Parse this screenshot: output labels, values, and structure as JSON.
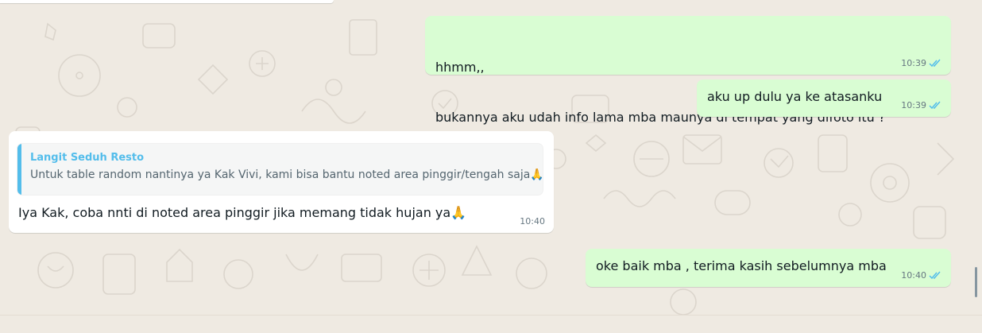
{
  "colors": {
    "background": "#efeae2",
    "outgoing_bubble": "#d9fdd3",
    "incoming_bubble": "#ffffff",
    "read_tick": "#53bdeb",
    "quote_accent": "#53bdeb"
  },
  "messages": [
    {
      "direction": "outgoing",
      "lines": [
        "hhmm,,",
        "bukannya aku udah info lama mba maunya di tempat yang difoto itu ?"
      ],
      "time": "10:39",
      "status_icon": "double-check-read-icon"
    },
    {
      "direction": "outgoing",
      "lines": [
        "aku up dulu ya ke atasanku"
      ],
      "time": "10:39",
      "status_icon": "double-check-read-icon"
    },
    {
      "direction": "incoming",
      "quoted": {
        "author": "Langit Seduh Resto",
        "text": "Untuk table random nantinya ya Kak Vivi, kami bisa bantu noted area pinggir/tengah saja🙏☺️"
      },
      "lines": [
        "Iya Kak, coba nnti di noted area pinggir jika memang tidak hujan ya🙏"
      ],
      "time": "10:40"
    },
    {
      "direction": "outgoing",
      "lines": [
        "oke baik mba , terima kasih sebelumnya mba"
      ],
      "time": "10:40",
      "status_icon": "double-check-read-icon"
    }
  ]
}
